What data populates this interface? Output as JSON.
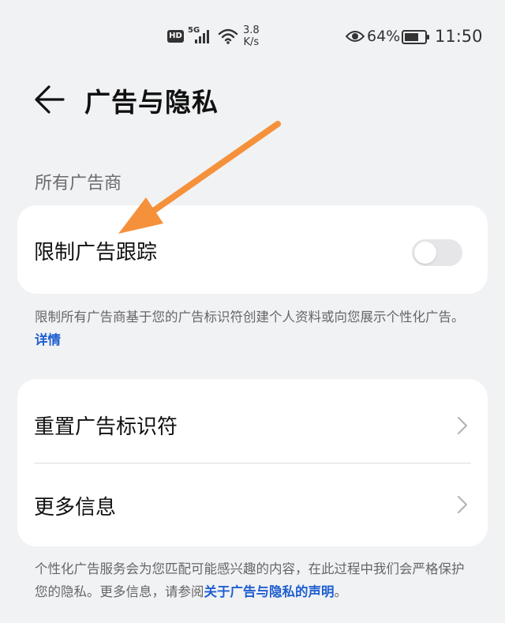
{
  "status_bar": {
    "hd": "HD",
    "network": "5G",
    "speed_value": "3.8",
    "speed_unit": "K/s",
    "battery_percent": "64%",
    "time": "11:50"
  },
  "header": {
    "title": "广告与隐私"
  },
  "section": {
    "title": "所有广告商"
  },
  "limit_tracking": {
    "label": "限制广告跟踪",
    "enabled": false,
    "description": "限制所有广告商基于您的广告标识符创建个人资料或向您展示个性化广告。",
    "details_link": "详情"
  },
  "menu": {
    "reset_label": "重置广告标识符",
    "more_info_label": "更多信息"
  },
  "footer": {
    "description": "个性化广告服务会为您匹配可能感兴趣的内容，在此过程中我们会严格保护您的隐私。更多信息，请参阅",
    "statement_link": "关于广告与隐私的声明",
    "end_punct": "。"
  },
  "colors": {
    "background": "#f1f2f4",
    "card": "#ffffff",
    "link": "#1f5fd1",
    "annotation_arrow": "#f5913b",
    "toggle_off": "#e6e6e8"
  },
  "icons": {
    "back": "arrow-left-icon",
    "chevron": "chevron-right-icon",
    "eye": "eye-icon",
    "battery": "battery-icon",
    "wifi": "wifi-icon",
    "signal": "signal-icon"
  }
}
